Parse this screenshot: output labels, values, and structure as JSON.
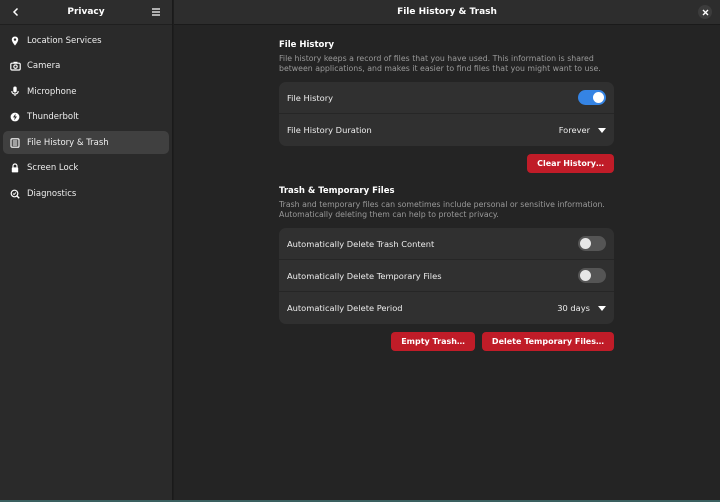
{
  "sidebar": {
    "title": "Privacy",
    "items": [
      {
        "label": "Location Services",
        "icon": "location-pin-icon"
      },
      {
        "label": "Camera",
        "icon": "camera-icon"
      },
      {
        "label": "Microphone",
        "icon": "microphone-icon"
      },
      {
        "label": "Thunderbolt",
        "icon": "thunderbolt-icon"
      },
      {
        "label": "File History & Trash",
        "icon": "file-history-icon",
        "active": true
      },
      {
        "label": "Screen Lock",
        "icon": "lock-icon"
      },
      {
        "label": "Diagnostics",
        "icon": "diagnostics-icon"
      }
    ]
  },
  "header": {
    "title": "File History & Trash"
  },
  "file_history": {
    "title": "File History",
    "description": "File history keeps a record of files that you have used. This information is shared between applications, and makes it easier to find files that you might want to use.",
    "toggle_label": "File History",
    "toggle_on": true,
    "duration_label": "File History Duration",
    "duration_value": "Forever",
    "clear_button": "Clear History…"
  },
  "trash": {
    "title": "Trash & Temporary Files",
    "description": "Trash and temporary files can sometimes include personal or sensitive information. Automatically deleting them can help to protect privacy.",
    "auto_trash_label": "Automatically Delete Trash Content",
    "auto_trash_on": false,
    "auto_temp_label": "Automatically Delete Temporary Files",
    "auto_temp_on": false,
    "period_label": "Automatically Delete Period",
    "period_value": "30 days",
    "empty_button": "Empty Trash…",
    "delete_temp_button": "Delete Temporary Files…"
  },
  "colors": {
    "accent": "#3584e4",
    "destructive": "#c01c28"
  }
}
